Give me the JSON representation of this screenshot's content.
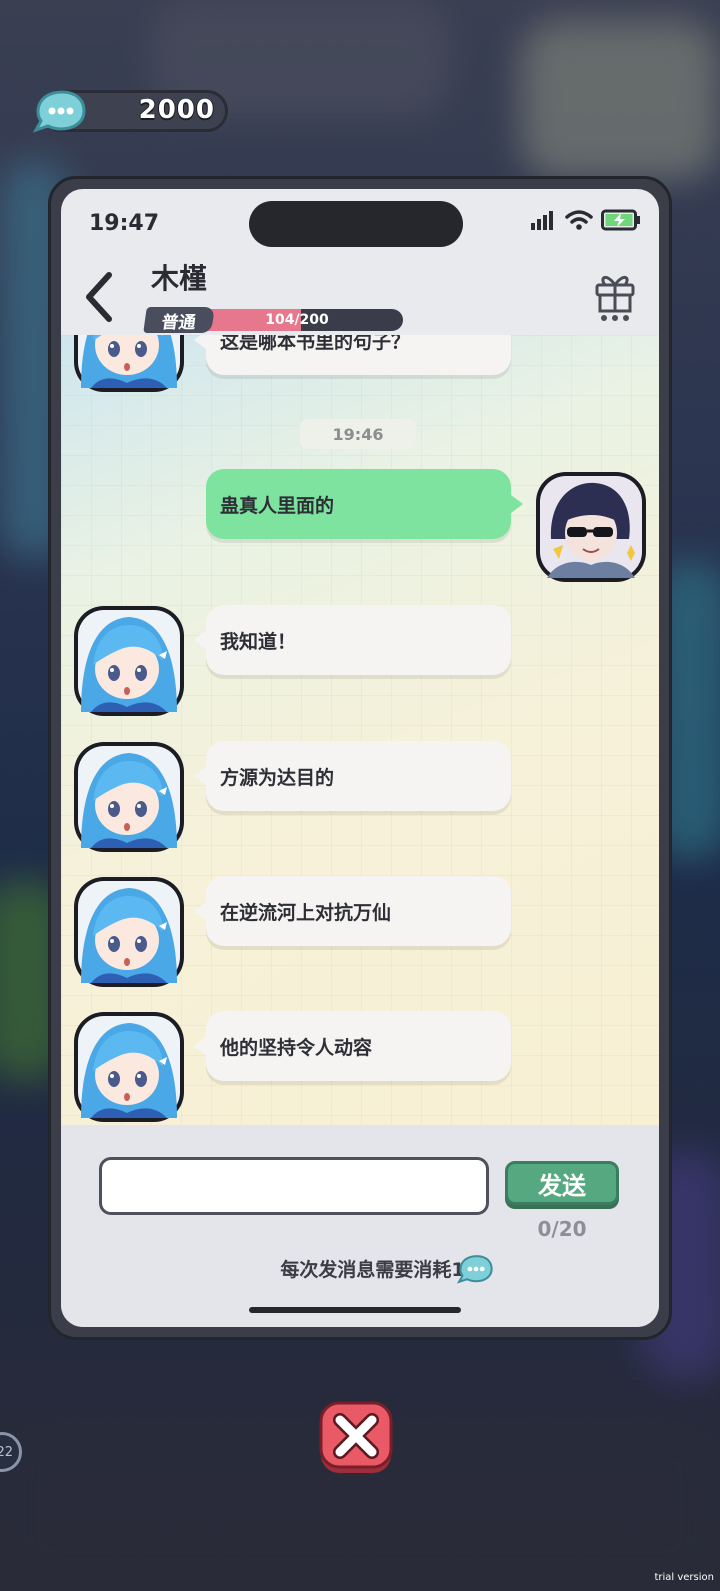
{
  "currency": {
    "value": "2000",
    "icon": "chat-bubble-coin-icon"
  },
  "status_bar": {
    "time": "19:47"
  },
  "header": {
    "contact_name": "木槿",
    "rank": "普通",
    "affinity_text": "104/200",
    "affinity_progress": 0.52
  },
  "messages": [
    {
      "side": "in",
      "text": "这是哪本书里的句子？"
    },
    {
      "side": "time",
      "text": "19:46"
    },
    {
      "side": "out",
      "text": "蛊真人里面的"
    },
    {
      "side": "in",
      "text": "我知道！"
    },
    {
      "side": "in",
      "text": "方源为达目的"
    },
    {
      "side": "in",
      "text": "在逆流河上对抗万仙"
    },
    {
      "side": "in",
      "text": "他的坚持令人动容"
    }
  ],
  "input": {
    "placeholder": "",
    "value": ""
  },
  "send_button": {
    "label": "发送"
  },
  "char_count": "0/20",
  "cost_note": "每次发消息需要消耗100",
  "side_badge": "22",
  "watermark": "trial version",
  "colors": {
    "outgoing_bubble": "#7fe3a0",
    "incoming_bubble": "#f5f4f2",
    "send_button": "#56a880",
    "affinity_fill": "#e7778c",
    "close_button": "#e95a66"
  }
}
